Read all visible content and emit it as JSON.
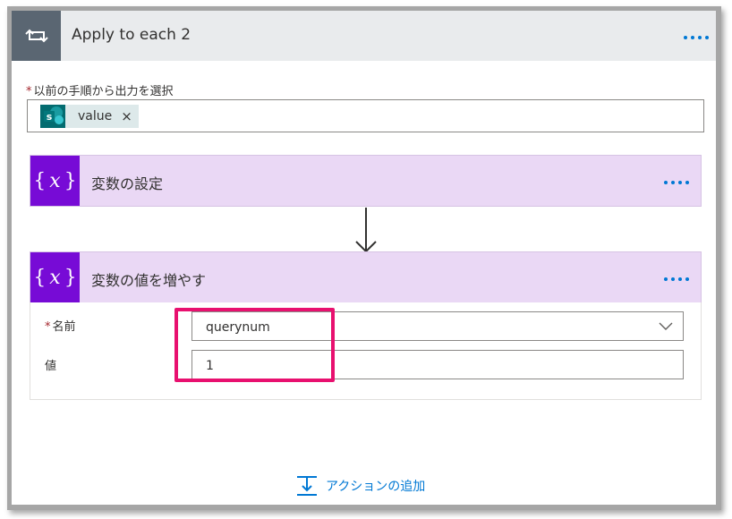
{
  "loop": {
    "title": "Apply to each 2",
    "field_label": "以前の手順から出力を選択",
    "token_label": "value",
    "token_remove": "×",
    "token_icon_letter": "s"
  },
  "set_variable": {
    "title": "変数の設定"
  },
  "increment_variable": {
    "title": "変数の値を増やす",
    "name_label": "名前",
    "name_value": "querynum",
    "value_label": "値",
    "value_value": "1"
  },
  "footer": {
    "add_action_label": "アクションの追加"
  },
  "required_marker": "*",
  "colors": {
    "accent": "#0078d4",
    "variable_purple": "#770bd6",
    "variable_header_bg": "#ead8f5",
    "sharepoint_teal": "#036c70",
    "highlight_pink": "#e8106f",
    "loop_icon_bg": "#5a6672"
  },
  "icons": {
    "loop": "loop-icon",
    "variable": "variable-icon",
    "sharepoint": "sharepoint-icon",
    "more": "more-options-icon",
    "chevron": "chevron-down-icon",
    "add_action": "add-action-icon"
  }
}
